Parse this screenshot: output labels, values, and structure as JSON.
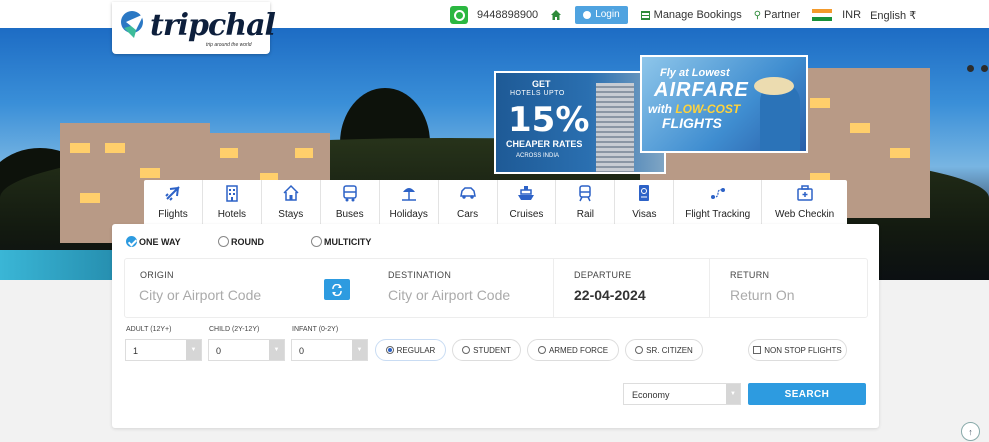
{
  "brand": {
    "name": "tripchal",
    "tagline": "trip around the world"
  },
  "topbar": {
    "phone": "9448898900",
    "login_label": "Login",
    "manage_label": "Manage Bookings",
    "partner_label": "Partner",
    "currency": "INR",
    "language": "English ₹"
  },
  "banners": {
    "hotels": {
      "line1": "GET",
      "line2": "HOTELS UPTO",
      "percent": "15%",
      "line3": "CHEAPER RATES",
      "line4": "ACROSS INDIA"
    },
    "airfare": {
      "line1": "Fly at Lowest",
      "line2": "AIRFARE",
      "line3a": "with ",
      "line3b": "LOW-COST",
      "line4": "FLIGHTS"
    }
  },
  "services": [
    {
      "label": "Flights",
      "icon": "plane-icon"
    },
    {
      "label": "Hotels",
      "icon": "hotel-icon"
    },
    {
      "label": "Stays",
      "icon": "house-icon"
    },
    {
      "label": "Buses",
      "icon": "bus-icon"
    },
    {
      "label": "Holidays",
      "icon": "beach-icon"
    },
    {
      "label": "Cars",
      "icon": "car-icon"
    },
    {
      "label": "Cruises",
      "icon": "ship-icon"
    },
    {
      "label": "Rail",
      "icon": "train-icon"
    },
    {
      "label": "Visas",
      "icon": "passport-icon"
    },
    {
      "label": "Flight Tracking",
      "icon": "route-icon"
    },
    {
      "label": "Web Checkin",
      "icon": "checkin-icon"
    }
  ],
  "trip_types": {
    "one_way": "ONE WAY",
    "round": "ROUND",
    "multicity": "MULTICITY",
    "selected": "one_way"
  },
  "fields": {
    "origin_label": "ORIGIN",
    "origin_placeholder": "City or Airport Code",
    "destination_label": "DESTINATION",
    "destination_placeholder": "City or Airport Code",
    "departure_label": "DEPARTURE",
    "departure_value": "22-04-2024",
    "return_label": "RETURN",
    "return_placeholder": "Return On"
  },
  "passengers": {
    "adult_label": "ADULT (12Y+)",
    "adult_value": "1",
    "child_label": "CHILD (2Y-12Y)",
    "child_value": "0",
    "infant_label": "INFANT (0-2Y)",
    "infant_value": "0"
  },
  "fare_types": {
    "regular": "REGULAR",
    "student": "STUDENT",
    "armed_force": "ARMED FORCE",
    "sr_citizen": "SR. CITIZEN",
    "selected": "regular"
  },
  "non_stop_label": "NON STOP FLIGHTS",
  "cabin_class": "Economy",
  "search_label": "SEARCH",
  "colors": {
    "accent": "#2d9be0",
    "whatsapp": "#2bb741",
    "login": "#4fa3e0"
  }
}
